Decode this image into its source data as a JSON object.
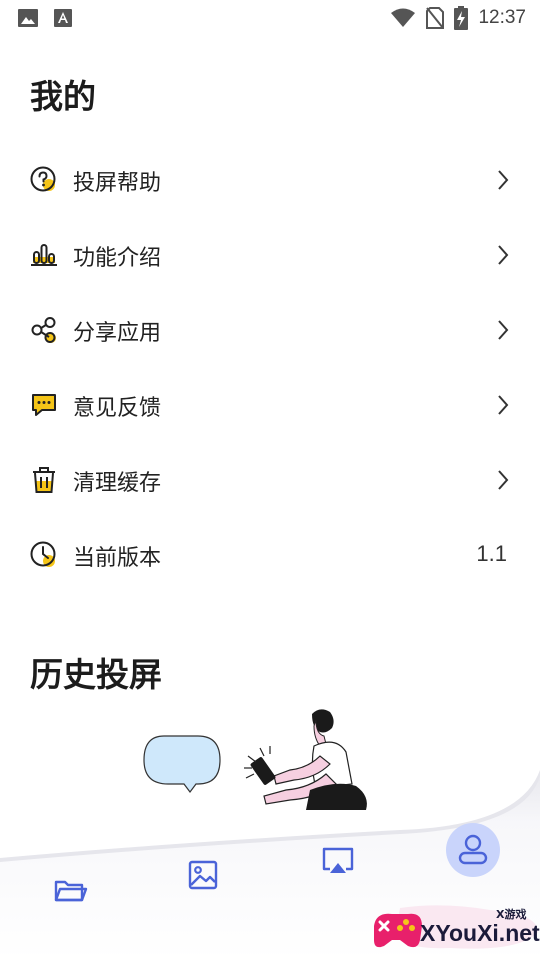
{
  "status_bar": {
    "time": "12:37"
  },
  "header": {
    "title": "我的"
  },
  "menu": {
    "items": [
      {
        "label": "投屏帮助",
        "icon": "help-question-icon"
      },
      {
        "label": "功能介绍",
        "icon": "bar-chart-icon"
      },
      {
        "label": "分享应用",
        "icon": "share-icon"
      },
      {
        "label": "意见反馈",
        "icon": "chat-bubble-icon"
      },
      {
        "label": "清理缓存",
        "icon": "trash-icon"
      },
      {
        "label": "当前版本",
        "icon": "clock-icon",
        "value": "1.1"
      }
    ]
  },
  "history": {
    "title": "历史投屏"
  },
  "bottom_nav": {
    "items": [
      {
        "icon": "folder-icon"
      },
      {
        "icon": "image-icon"
      },
      {
        "icon": "screen-cast-icon"
      },
      {
        "icon": "profile-icon",
        "active": true
      }
    ]
  },
  "watermark": {
    "text": "XYouXi.net",
    "small_text": "X游戏"
  },
  "colors": {
    "accent": "#4a63d8",
    "accent_light": "#c9d4fb",
    "icon_yellow": "#f5c518",
    "bubble": "#cfe8fb",
    "pink": "#f6cfe0"
  }
}
